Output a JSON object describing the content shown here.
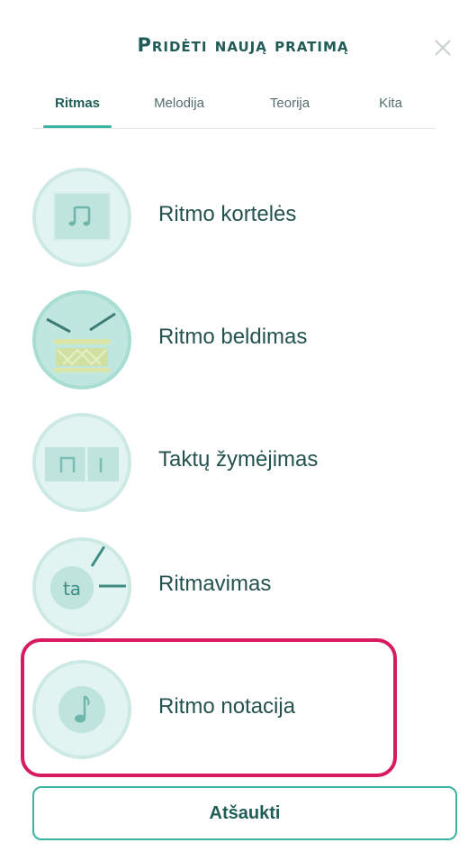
{
  "dialog": {
    "title": "Pridėti naują pratimą",
    "close_icon": "close-icon"
  },
  "tabs": [
    {
      "label": "Ritmas",
      "active": true
    },
    {
      "label": "Melodija",
      "active": false
    },
    {
      "label": "Teorija",
      "active": false
    },
    {
      "label": "Kita",
      "active": false
    }
  ],
  "exercises": [
    {
      "label": "Ritmo kortelės",
      "icon": "rhythm-card-icon"
    },
    {
      "label": "Ritmo beldimas",
      "icon": "drum-icon"
    },
    {
      "label": "Taktų žymėjimas",
      "icon": "bar-lines-icon"
    },
    {
      "label": "Ritmavimas",
      "icon": "ta-icon"
    },
    {
      "label": "Ritmo notacija",
      "icon": "music-note-icon",
      "highlighted": true
    }
  ],
  "footer": {
    "cancel_label": "Atšaukti"
  },
  "colors": {
    "accent": "#3bb3a3",
    "highlight": "#d81b60",
    "icon_bg": "#e2f4f1",
    "text": "#24524f"
  }
}
